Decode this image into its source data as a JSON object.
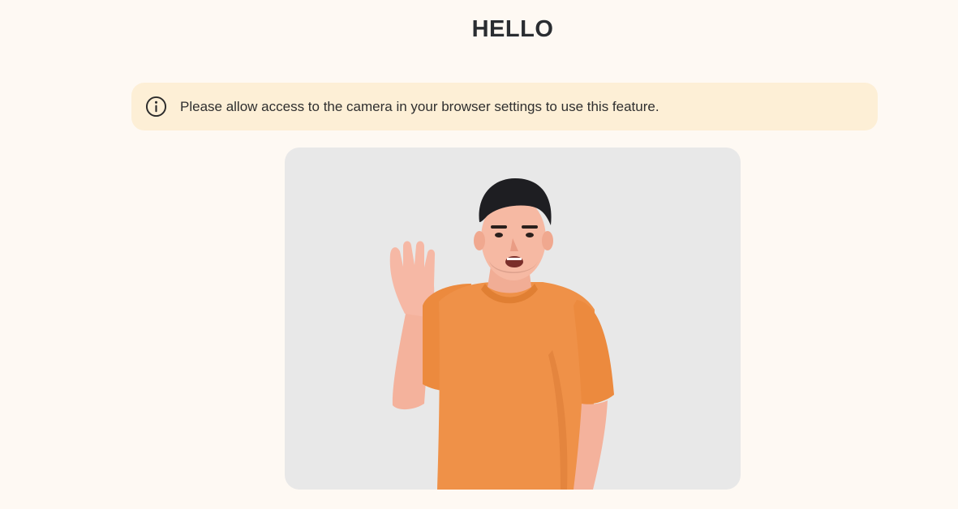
{
  "page": {
    "title": "HELLO"
  },
  "notice": {
    "message": "Please allow access to the camera in your browser settings to use this feature.",
    "icon": "info-icon"
  },
  "video": {
    "subject": "person-waving"
  },
  "colors": {
    "background": "#fef9f3",
    "banner": "#fdefd6",
    "video_bg": "#e8e8e8",
    "shirt": "#ef9148"
  }
}
